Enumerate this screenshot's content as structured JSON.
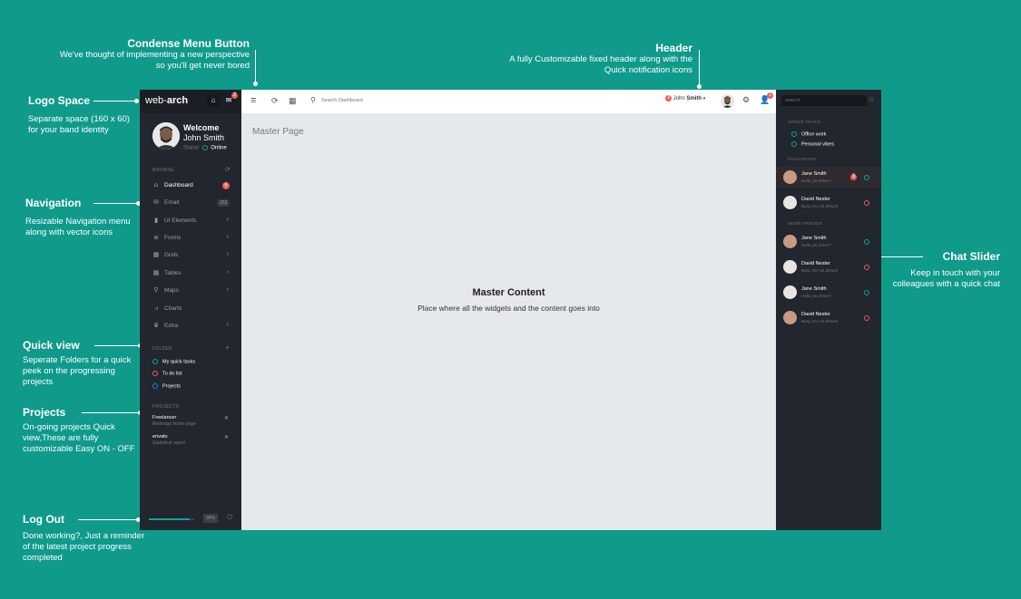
{
  "annotations": {
    "condense": {
      "title": "Condense Menu Button",
      "desc1": "We've thought of implementing a new perspective",
      "desc2": "so you'll get never bored"
    },
    "header": {
      "title": "Header",
      "desc1": "A fully Customizable fixed header along with the",
      "desc2": "Quick notification icons"
    },
    "logo": {
      "title": "Logo Space",
      "desc1": "Separate space (160 x 60)",
      "desc2": "for your band identity"
    },
    "navigation": {
      "title": "Navigation",
      "desc1": "Resizable Navigation menu",
      "desc2": "along with vector icons"
    },
    "quickview": {
      "title": "Quick view",
      "desc1": "Seperate Folders for a quick",
      "desc2": "peek on the progressing",
      "desc3": "projects"
    },
    "projects": {
      "title": "Projects",
      "desc1": "On-going projects Quick",
      "desc2": "view,These are fully",
      "desc3": "customizable  Easy ON - OFF"
    },
    "logout": {
      "title": "Log Out",
      "desc1": "Done working?, Just a reminder",
      "desc2": "of the latest project progress",
      "desc3": "completed"
    },
    "chat": {
      "title": "Chat Slider",
      "desc1": "Keep in touch with your",
      "desc2": "colleagues with a quick chat"
    },
    "master": {
      "title": "Master Content",
      "desc": "Place where all the widgets and the content goes into"
    }
  },
  "logo": {
    "brand_a": "web-",
    "brand_b": "arch",
    "notif_count": "2",
    "home_icon": "⌂",
    "mail_icon": "✉"
  },
  "profile": {
    "welcome": "Welcome",
    "name": "John Smith",
    "status_label": "Status",
    "status_value": "Online"
  },
  "colors": {
    "online": "#0aa699",
    "danger": "#f35958",
    "info": "#0090d9",
    "accent": "#0f9a8a"
  },
  "sidebar": {
    "browse_label": "BROWSE",
    "items": [
      {
        "label": "Dashboard",
        "icon": "home-icon",
        "glyph": "⌂",
        "badge": "6"
      },
      {
        "label": "Email",
        "icon": "mail-icon",
        "glyph": "✉",
        "badge": "263"
      },
      {
        "label": "UI Elements",
        "icon": "bookmark-icon",
        "glyph": "▮"
      },
      {
        "label": "Forms",
        "icon": "list-icon",
        "glyph": "≣"
      },
      {
        "label": "Grids",
        "icon": "grid-icon",
        "glyph": "▦"
      },
      {
        "label": "Tables",
        "icon": "table-icon",
        "glyph": "▦"
      },
      {
        "label": "Maps",
        "icon": "map-pin-icon",
        "glyph": "⚲"
      },
      {
        "label": "Charts",
        "icon": "chart-icon",
        "glyph": "⩘"
      },
      {
        "label": "Extra",
        "icon": "crown-icon",
        "glyph": "♛"
      }
    ],
    "folder_label": "FOLDER",
    "folders": [
      "My quick tasks",
      "To do list",
      "Projects"
    ],
    "projects_label": "PROJECTS",
    "projects": [
      {
        "name": "Freelancer",
        "desc": "Redesign home page"
      },
      {
        "name": "envato",
        "desc": "Statistical report"
      }
    ],
    "progress_percent": 90,
    "progress_label": "90%"
  },
  "header": {
    "menu_icon": "≡",
    "refresh_icon": "⟳",
    "apps_icon": "▦",
    "search_placeholder": "Search Dashboard",
    "user_badge": "3",
    "user_first": "John",
    "user_last": "Smith",
    "notif_badge": "1"
  },
  "content": {
    "page_title": "Master Page"
  },
  "chat": {
    "search_placeholder": "search",
    "group_label": "GROUP CHATS",
    "groups": [
      "Office work",
      "Personal vibes"
    ],
    "fav_label": "FAVOURITES",
    "favourites": [
      {
        "name": "Jane Smith",
        "msg": "Hello you there?",
        "badge": "3",
        "status": "online"
      },
      {
        "name": "David Nester",
        "msg": "Busy, Do not disturb",
        "status": "busy"
      }
    ],
    "more_label": "MORE FRIENDS",
    "friends": [
      {
        "name": "Jane Smith",
        "msg": "Hello you there?",
        "status": "online"
      },
      {
        "name": "David Nester",
        "msg": "Busy, Do not disturb",
        "status": "busy"
      },
      {
        "name": "Jane Smith",
        "msg": "Hello you there?",
        "status": "online"
      },
      {
        "name": "David Nester",
        "msg": "Busy, Do not disturb",
        "status": "busy"
      }
    ]
  }
}
